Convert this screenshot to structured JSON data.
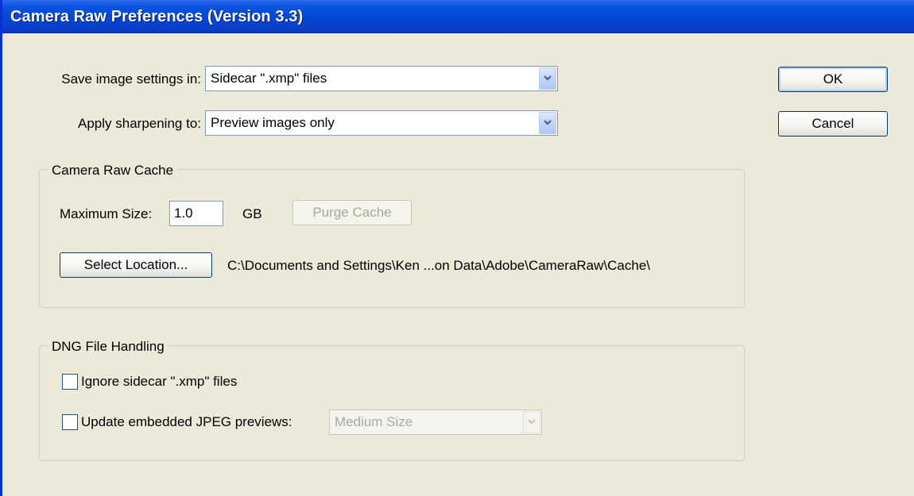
{
  "window": {
    "title": "Camera Raw Preferences  (Version 3.3)"
  },
  "settings": {
    "save_label": "Save image settings in:",
    "save_value": "Sidecar \".xmp\" files",
    "sharpen_label": "Apply sharpening to:",
    "sharpen_value": "Preview images only"
  },
  "actions": {
    "ok_label": "OK",
    "cancel_label": "Cancel"
  },
  "cache": {
    "title": "Camera Raw Cache",
    "max_size_label": "Maximum Size:",
    "max_size_value": "1.0",
    "unit": "GB",
    "purge_label": "Purge Cache",
    "select_location_label": "Select Location...",
    "path": "C:\\Documents and Settings\\Ken ...on Data\\Adobe\\CameraRaw\\Cache\\"
  },
  "dng": {
    "title": "DNG File Handling",
    "ignore_sidecar_label": "Ignore sidecar \".xmp\" files",
    "ignore_sidecar_checked": false,
    "update_previews_label": "Update embedded JPEG previews:",
    "update_previews_checked": false,
    "preview_size_value": "Medium Size"
  },
  "icons": {
    "dropdown": "chevron-down-icon"
  },
  "colors": {
    "titlebar": "#0345D6",
    "dialog_bg": "#ECE9D8",
    "disabled_text": "#ACA899"
  }
}
